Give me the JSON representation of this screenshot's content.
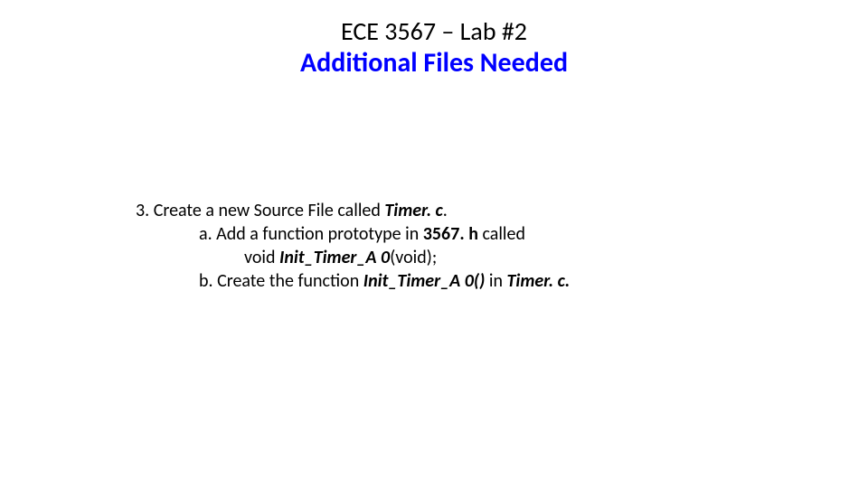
{
  "header": {
    "title": "ECE 3567 – Lab #2",
    "subtitle": "Additional Files Needed"
  },
  "content": {
    "item_number": "3.",
    "item_text_pre": " Create a new Source File called ",
    "item_text_file": "Timer. c",
    "item_text_post": ".",
    "sub_a_label": "a.",
    "sub_a_text_pre": "  Add a function prototype in ",
    "sub_a_file": "3567. h",
    "sub_a_text_post": " called",
    "sub_a_line2_pre": "void ",
    "sub_a_func": "Init_Timer_A 0",
    "sub_a_line2_post": "(void);",
    "sub_b_label": "b.",
    "sub_b_text_pre": "  Create the function ",
    "sub_b_func": "Init_Timer_A 0()",
    "sub_b_text_mid": " in ",
    "sub_b_file": "Timer. c.",
    "sub_b_text_post": ""
  }
}
